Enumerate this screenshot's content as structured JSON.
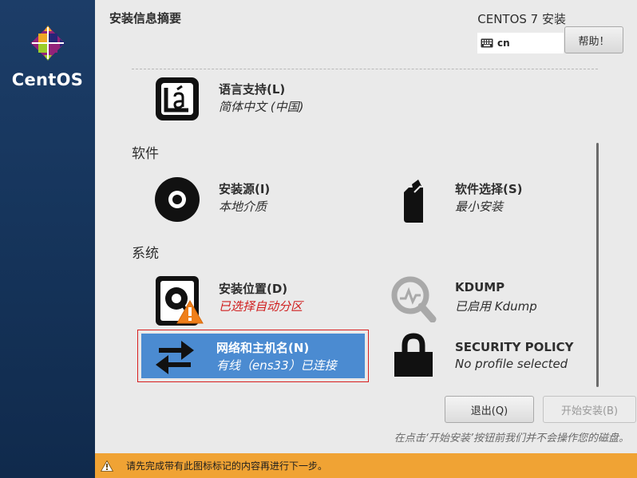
{
  "sidebar": {
    "brand": "CentOS"
  },
  "header": {
    "title": "安装信息摘要",
    "product": "CENTOS 7 安装",
    "keyboard_layout": "cn",
    "help_label": "帮助！"
  },
  "localization": {
    "language": {
      "title": "语言支持(L)",
      "status": "简体中文 (中国)"
    }
  },
  "software": {
    "category": "软件",
    "source": {
      "title": "安装源(I)",
      "status": "本地介质"
    },
    "selection": {
      "title": "软件选择(S)",
      "status": "最小安装"
    }
  },
  "system": {
    "category": "系统",
    "destination": {
      "title": "安装位置(D)",
      "status": "已选择自动分区"
    },
    "kdump": {
      "title": "KDUMP",
      "status": "已启用 Kdump"
    },
    "network": {
      "title": "网络和主机名(N)",
      "status": "有线（ens33）已连接"
    },
    "security": {
      "title": "SECURITY POLICY",
      "status": "No profile selected"
    }
  },
  "footer": {
    "quit_label": "退出(Q)",
    "begin_label": "开始安装(B)",
    "hint": "在点击‘开始安装’按钮前我们并不会操作您的磁盘。",
    "warning": "请先完成带有此图标标记的内容再进行下一步。"
  },
  "colors": {
    "sidebar": "#16355c",
    "selected_spoke": "#4b8bd1",
    "warning_bar": "#f0a334",
    "warning_text": "#d01f1f"
  }
}
